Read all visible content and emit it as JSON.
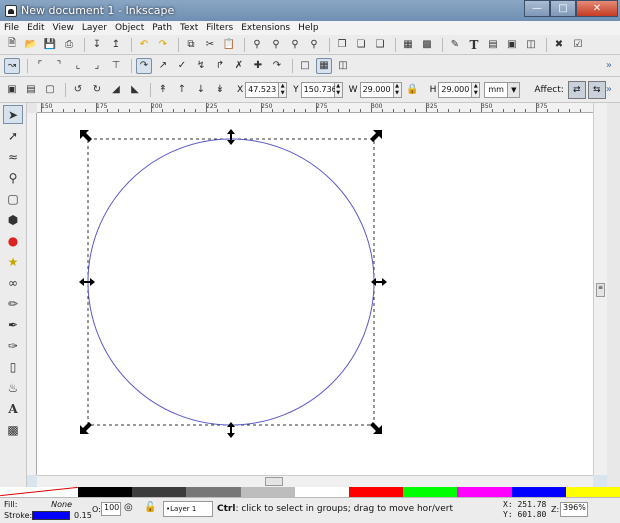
{
  "window": {
    "title": "New document 1 - Inkscape"
  },
  "menu": [
    "File",
    "Edit",
    "View",
    "Layer",
    "Object",
    "Path",
    "Text",
    "Filters",
    "Extensions",
    "Help"
  ],
  "tool_controls": {
    "x_label": "X",
    "x_value": "47.523",
    "y_label": "Y",
    "y_value": "150.736",
    "w_label": "W",
    "w_value": "29.000",
    "h_label": "H",
    "h_value": "29.000",
    "unit": "mm",
    "affect_label": "Affect:"
  },
  "ruler_labels": [
    "150",
    "175",
    "200",
    "225",
    "250",
    "275",
    "300",
    "325",
    "350",
    "375"
  ],
  "palette": [
    "#000000",
    "#3c3c3c",
    "#777777",
    "#bdbdbd",
    "#ffffff",
    "#ff0000",
    "#00ff00",
    "#ff00ff",
    "#0000ff",
    "#ffff00"
  ],
  "status": {
    "fill_label": "Fill:",
    "fill_value": "None",
    "stroke_label": "Stroke:",
    "stroke_color": "#0000ff",
    "stroke_width": "0.15",
    "opacity_label": "O:",
    "opacity_value": "100",
    "layer": "•Layer 1",
    "message_key": "Ctrl",
    "message_text": ": click to select in groups; drag to move hor/vert",
    "x_coord": "X:  251.78",
    "y_coord": "Y:  601.80",
    "zoom_label": "Z:",
    "zoom_value": "396%"
  }
}
